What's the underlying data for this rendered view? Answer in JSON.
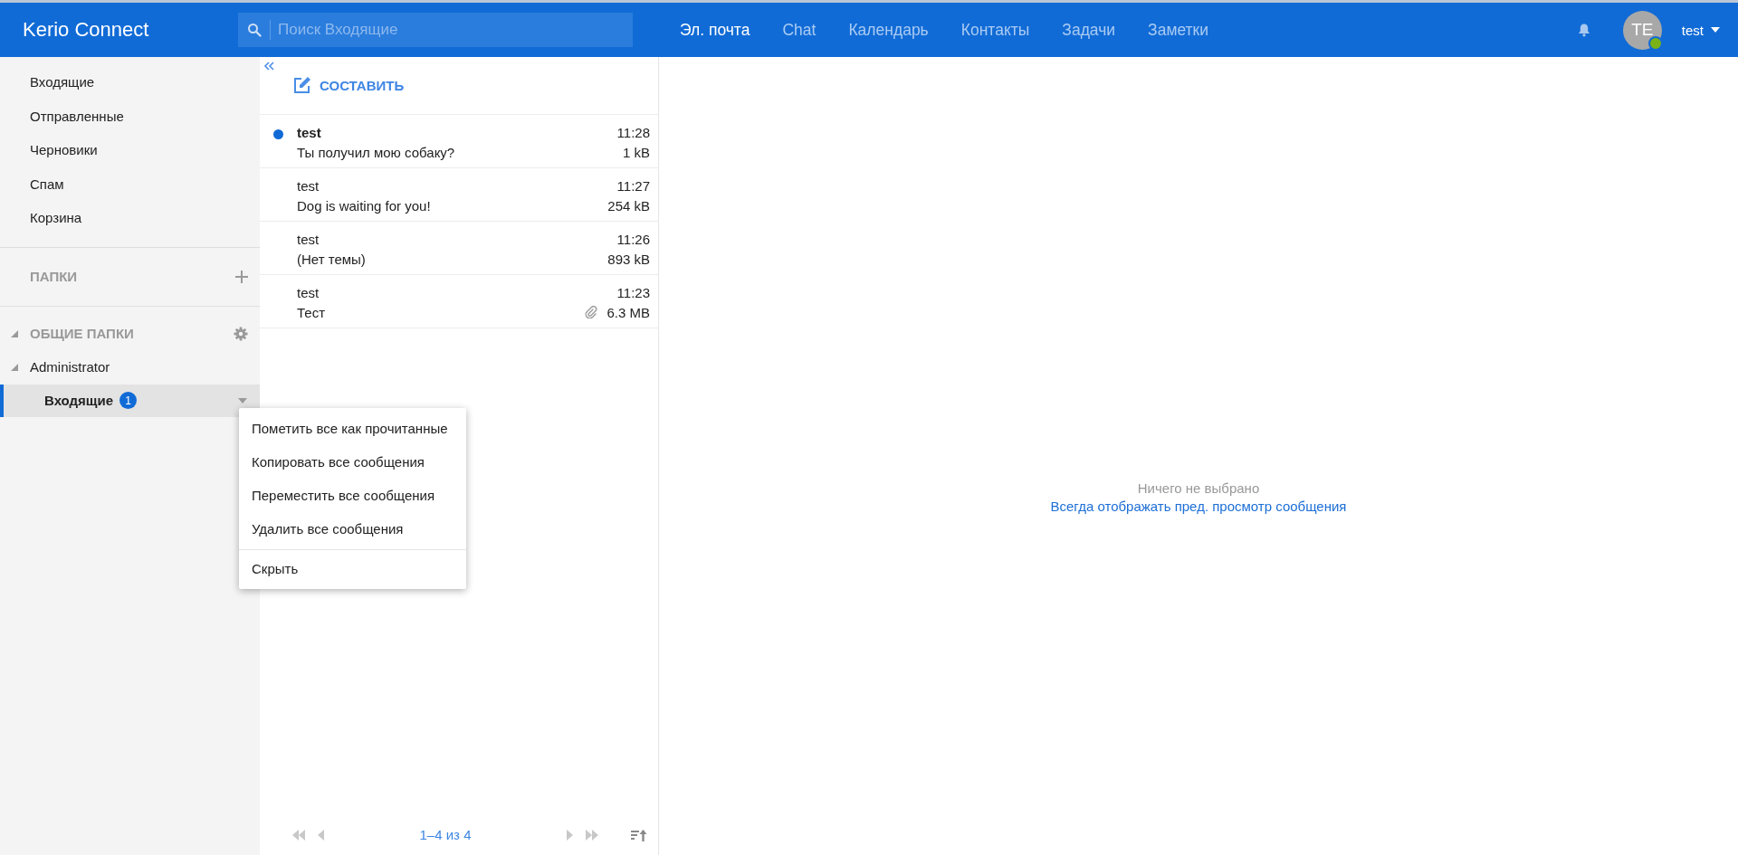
{
  "header": {
    "logo": "Kerio Connect",
    "search": {
      "placeholder": "Поиск Входящие"
    },
    "tabs": [
      {
        "label": "Эл. почта",
        "selected": true
      },
      {
        "label": "Chat",
        "selected": false
      },
      {
        "label": "Календарь",
        "selected": false
      },
      {
        "label": "Контакты",
        "selected": false
      },
      {
        "label": "Задачи",
        "selected": false
      },
      {
        "label": "Заметки",
        "selected": false
      }
    ],
    "user": {
      "initials": "TE",
      "name": "test",
      "online": true
    }
  },
  "sidebar": {
    "items": [
      {
        "label": "Входящие",
        "selected": false
      },
      {
        "label": "Отправленные",
        "selected": false
      },
      {
        "label": "Черновики",
        "selected": false
      },
      {
        "label": "Спам",
        "selected": false
      },
      {
        "label": "Корзина",
        "selected": false
      }
    ],
    "folders_heading": "ПАПКИ",
    "shared": {
      "label": "ОБЩИЕ ПАПКИ",
      "expanded": true,
      "children": [
        {
          "label": "Administrator",
          "expanded": true,
          "children": [
            {
              "label": "Входящие",
              "badge": "1",
              "selected": true
            }
          ]
        }
      ]
    }
  },
  "context_menu": [
    {
      "label": "Пометить все как прочитанные",
      "divider_before": false
    },
    {
      "label": "Копировать все сообщения",
      "divider_before": false
    },
    {
      "label": "Переместить все сообщения",
      "divider_before": false
    },
    {
      "label": "Удалить все сообщения",
      "divider_before": false
    },
    {
      "label": "Скрыть",
      "divider_before": true
    }
  ],
  "toolbar": {
    "compose": "СОСТАВИТЬ"
  },
  "messages": [
    {
      "sender": "test",
      "subject": "Ты получил мою собаку?",
      "time": "11:28",
      "size": "1 kB",
      "unread": true,
      "attachment": false
    },
    {
      "sender": "test",
      "subject": "Dog is waiting for you!",
      "time": "11:27",
      "size": "254 kB",
      "unread": false,
      "attachment": false
    },
    {
      "sender": "test",
      "subject": "(Нет темы)",
      "time": "11:26",
      "size": "893 kB",
      "unread": false,
      "attachment": false
    },
    {
      "sender": "test",
      "subject": "Тест",
      "time": "11:23",
      "size": "6.3 MB",
      "unread": false,
      "attachment": true
    }
  ],
  "pager": {
    "range": "1–4 из 4"
  },
  "preview": {
    "empty_text": "Ничего не выбрано",
    "link": "Всегда отображать пред. просмотр сообщения"
  }
}
